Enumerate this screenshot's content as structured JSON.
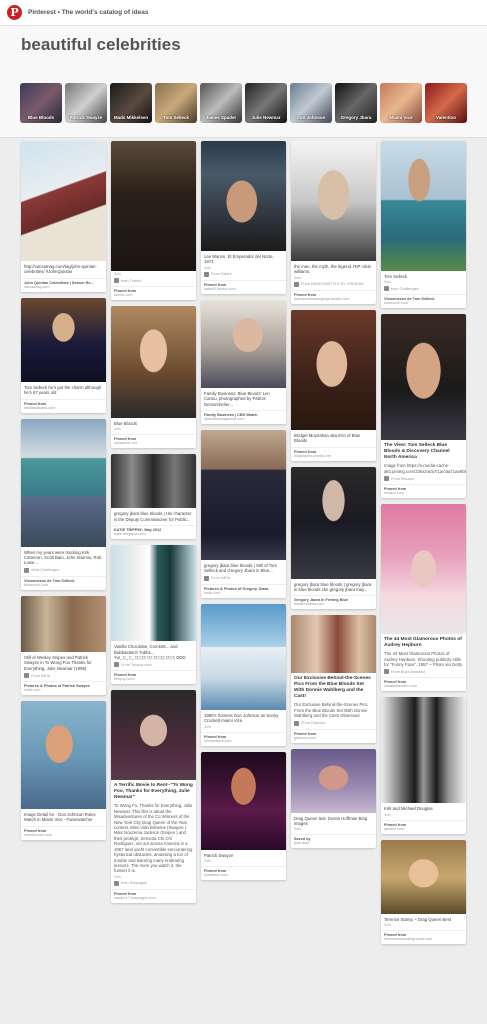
{
  "topbar": {
    "title": "Pinterest • The world's catalog of ideas",
    "logo": "P"
  },
  "header": {
    "title": "beautiful celebrities"
  },
  "chips": [
    {
      "label": "Blue Bloods",
      "bg": "linear-gradient(135deg,#3b3a5c,#7a5a6a 50%,#2a2a3a)"
    },
    {
      "label": "Patrick Swayze",
      "bg": "linear-gradient(135deg,#777,#d0d0d0 50%,#444)"
    },
    {
      "label": "Mads Mikkelsen",
      "bg": "linear-gradient(135deg,#1a1a1a,#5a4a40 55%,#111)"
    },
    {
      "label": "Tom Selleck",
      "bg": "linear-gradient(135deg,#8a7050,#c9a97a 50%,#4a3a28)"
    },
    {
      "label": "James Spader",
      "bg": "linear-gradient(135deg,#555,#bbb 50%,#333)"
    },
    {
      "label": "Julie Newmar",
      "bg": "linear-gradient(135deg,#222,#777 50%,#111)"
    },
    {
      "label": "Don Johnson",
      "bg": "linear-gradient(135deg,#6a7e90,#c0cad2 50%,#445)"
    },
    {
      "label": "Gregory Jbara",
      "bg": "linear-gradient(135deg,#111,#666 50%,#222)"
    },
    {
      "label": "Miami Vice",
      "bg": "linear-gradient(135deg,#c47a5a,#e8b890 50%,#8a4a3a)"
    },
    {
      "label": "Valentino",
      "bg": "linear-gradient(135deg,#8a1a1a,#d46a4a 50%,#5a1010)"
    }
  ],
  "columns": [
    [
      {
        "img_h": 120,
        "bg": "linear-gradient(160deg,#cfe3ec,#e8eef0 40%,#8a3a38 41%,#6a2a28 62%,#e9e3d6 63%)",
        "desc": "http://cacsamag.com/tag/john-quinlan-celebrities/ #JohnQuinlan",
        "count": "",
        "by": "",
        "src_label": "John Quinlan Celebrities | Search Re...",
        "src_url": "cacsamag.com"
      },
      {
        "img_h": 84,
        "bg": "radial-gradient(ellipse at 50% 35%,#d6b08a 0 18%,transparent 19%),linear-gradient(180deg,#6a4a30,#1a1a3a 55%,#0f0f22)",
        "desc": "Tom Selleck he's got the charm although he's 67 years old",
        "count": "",
        "by": "",
        "src_label": "Pinned from",
        "src_url": "takeawalkand.com"
      },
      {
        "img_h": 128,
        "bg": "linear-gradient(180deg,#8aa7c0,#d6dde2 30%,#4a9a9a 31%,#3a7a8a 60%,#5a6a8a 61%,#3a4a5a)",
        "desc": "When my years were tracking Kirk Cameron, Scott Baio, John Stamos, Rob Lowe...",
        "count": "",
        "by": "Vivia Challenges",
        "src_label": "Visionnesse de Tom Selleck",
        "src_url": "budecore.com"
      },
      {
        "img_h": 56,
        "bg": "linear-gradient(90deg,#6a5a4a,#c8b498 30%,#8a6a50 60%,#b49070)",
        "desc": "Still of Wesley Snipes and Patrick Swayze in To Wong Foo Thanks for Everything, Julie Newmar (1995)",
        "count": "",
        "by": "From IMDb",
        "src_label": "Pictures & Photos of Patrick Swayze",
        "src_url": "imdb.com"
      },
      {
        "img_h": 108,
        "bg": "radial-gradient(ellipse at 45% 40%,#d9a07a 0 20%,transparent 21%),linear-gradient(180deg,#8ab4cc,#6a9ab8 50%,#4a6a8a)",
        "desc": "Image Detail for - Don Johnson Rolex Watch in Miami Vice - Famewatcher",
        "count": "",
        "by": "",
        "src_label": "Pinned from",
        "src_url": "rolexforums.com"
      }
    ],
    [
      {
        "img_h": 130,
        "bg": "linear-gradient(180deg,#5a4a3a,#2a2018 40%,#1a1512)",
        "desc": "",
        "count": "3sfs",
        "by": "from Tumblr",
        "src_label": "Pinned from",
        "src_url": "tumblr.com"
      },
      {
        "img_h": 112,
        "bg": "radial-gradient(ellipse at 50% 40%,#e6c0a0 0 22%,transparent 23%),linear-gradient(180deg,#b08a60,#6a4a30 60%,#2a2a2a)",
        "desc": "Blue Bloods",
        "count": "3sfs",
        "by": "",
        "src_label": "Pinned from",
        "src_url": "cellardoor.net"
      },
      {
        "img_h": 54,
        "bg": "linear-gradient(90deg,#333,#8a8a8a 25%,#2a2a2a 50%,#777 75%,#333)",
        "desc": "gregory jbara blue bloods | His character is the Deputy Commissioner for Public...",
        "count": "",
        "by": "",
        "src_label": "KATIE TRIPPIN': May 2012",
        "src_url": "katie.blogspot.com"
      },
      {
        "img_h": 96,
        "bg": "linear-gradient(90deg,#c8e0e8,#f0f0f0 30%,#ffffff 45%,#2a5a5a 55%,#1a3a3a 70%,#c8e0e8)",
        "desc": "Vanilla Chocolate, Crockett... and Bubbastetch Tubbs... Yu!_!;;_!;;_!;!;!;!;!;!;!;!;!;!;!;!;!;!;!;!;!; DDD",
        "count": "",
        "by": "From Tenpop.com",
        "src_label": "Pinned from",
        "src_url": "flenpop.com"
      },
      {
        "img_h": 90,
        "bg": "radial-gradient(ellipse at 50% 45%,#d4b4a4 0 22%,transparent 23%),linear-gradient(180deg,#2a2a2a,#4a2a3a 60%,#5a3a4a)",
        "desc": "A Terrific Movie to Rent--\"To Wong Foo, Thanks for Everything, Julie Newmar\"",
        "bold": true,
        "desc2": "To Wong Fu, Thanks for Everything, Julie Newmar. This film is about the Misadventures of the Co Winners of the New York City Drag Queen of the Year contest. Miss Vida Boheme (Swayze ) Miss Noxzema Jackson (Snipes ) and their protégé, Senorita Chi Chi Rodriguez, set out across America in a 1967 land yacht convertible encountering hysterical obstacles, amassing a ton of trouble and learning many endearing lessons. The more you watch it, the funnier it is.",
        "count": "3sfs",
        "by": "from Hubpages",
        "src_label": "Pinned from",
        "src_url": "zander17.hubpages.com"
      }
    ],
    [
      {
        "img_h": 110,
        "bg": "radial-gradient(ellipse at 48% 55%,#c89a7a 0 24%,transparent 25%),linear-gradient(180deg,#2a3a4a,#4a5a6a 30%,#1a1a1a)",
        "desc": "Lee Marvin, El Emperador del Norte, 1973",
        "count": "3sfs",
        "by": "Emm Sabell",
        "src_label": "Pinned from",
        "src_url": "sabell3.tumblr.com"
      },
      {
        "img_h": 88,
        "bg": "radial-gradient(ellipse at 55% 40%,#ddb8a0 0 22%,transparent 23%),linear-gradient(180deg,#e8e4dc,#a8a098 55%,#4a4a5a)",
        "desc": "Family Business: Blue Bloods' Len Cariou, photographed by Patrick Demarchelier...",
        "count": "",
        "by": "",
        "src_label": "Family Business | CBS Watch",
        "src_url": "cbswatchmagazine.com"
      },
      {
        "img_h": 130,
        "bg": "linear-gradient(180deg,#c0a890,#8a6a58 30%,#2a2a3a 31%,#1a1a2a 80%,#3a3a4a)",
        "desc": "gregory jbara blue bloods | Still of Tom Selleck and Gregory Jbara in Blue...",
        "count": "",
        "by": "From IMDb",
        "src_label": "Pictures & Photos of Gregory Jbara",
        "src_url": "imdb.com"
      },
      {
        "img_h": 106,
        "bg": "linear-gradient(180deg,#5a9ac8,#a8d0e8 40%,#e8f0f4 41%,#c8d8e4 70%,#5a8ab0)",
        "desc": "1980's hotness Don Johnson as Sonny Crockett miami Vice.",
        "count": "3sfs",
        "by": "",
        "src_label": "Pinned from",
        "src_url": "ohmymiami.com"
      },
      {
        "img_h": 98,
        "bg": "radial-gradient(ellipse at 50% 35%,#c47a5a 0 20%,transparent 21%),linear-gradient(180deg,#1a0a1a,#5a1a4a 60%,#2a0a2a)",
        "desc": "Patrick Swayze",
        "count": "3sfs",
        "by": "",
        "src_label": "Pinned from",
        "src_url": "suitafeed.com"
      }
    ],
    [
      {
        "img_h": 120,
        "bg": "radial-gradient(ellipse at 50% 45%,#d8c0a8 0 26%,transparent 27%),linear-gradient(180deg,#f4f4f4,#c8c8c8 50%,#3a3a3a)",
        "desc": "the man, the myth, the legend. RIP robin williams.",
        "count": "3sfs",
        "by": "From RANDOMSTYLE BY VIRGINIA",
        "src_label": "Pinned from",
        "src_url": "hanukcrefoodorginga.tumblr.com"
      },
      {
        "img_h": 120,
        "bg": "radial-gradient(ellipse at 48% 45%,#e0b89c 0 24%,transparent 25%),linear-gradient(180deg,#6a3a2a,#3a2018 60%,#2a1810)",
        "desc": "Bridget Moynahan aka Erin of Blue Bloods",
        "count": "",
        "by": "",
        "src_label": "Pinned from",
        "src_url": "wallpapers-photos.net"
      },
      {
        "img_h": 112,
        "bg": "radial-gradient(ellipse at 50% 30%,#d0b8a8 0 18%,transparent 19%),linear-gradient(180deg,#2a2a2a,#1a1a22 50%,#3a3a44)",
        "desc": "gregory jbara blue bloods | gregory jbara in blue bloods cbs gregory jbara may...",
        "count": "",
        "by": "",
        "src_label": "Gregory Jbara In Feeling Blue",
        "src_url": "theatermania.com"
      },
      {
        "img_h": 58,
        "bg": "linear-gradient(90deg,#aa8870,#e0c8b0 30%,#8a4a3a 55%,#dcc0a0 80%,#aa8870)",
        "desc": "Our Exclusive Behind-the-Scenes Pics From the Blue Bloods Set With Donnie Wahlberg and the Cast!",
        "bold": true,
        "desc2": "Our Exclusive Behind-the-Scenes Pics From the Blue Bloods Set With Donnie Wahlberg and the Cast! Obsessed",
        "count": "",
        "by": "From Glamour",
        "src_label": "Pinned from",
        "src_url": "glamour.com"
      },
      {
        "img_h": 64,
        "bg": "radial-gradient(ellipse at 50% 45%,#d09888 0 24%,transparent 25%),linear-gradient(180deg,#6a5a8a,#9a8ab0 60%,#c8b8d0)",
        "desc": "Drag Queen test: Dustin Hoffman Bing images",
        "count": "3sfs",
        "by": "",
        "src_label": "Saved by",
        "src_url": "jose diaz"
      }
    ],
    [
      {
        "img_h": 130,
        "bg": "radial-gradient(ellipse at 45% 30%,#c8a080 0 16%,transparent 17%),linear-gradient(180deg,#c8dce8,#a8c0d0 45%,#3a8a9a 46%,#2a6a7a 75%,#5a8a4a)",
        "desc": "Tom Selleck",
        "count": "3sfs",
        "by": "from Challenges",
        "src_label": "Visionnesse de Tom Selleck",
        "src_url": "budecore.com"
      },
      {
        "img_h": 126,
        "bg": "radial-gradient(ellipse at 50% 45%,#d4a484 0 28%,transparent 29%),linear-gradient(180deg,#3a2a22,#1a1a1a 60%,#3a3a44)",
        "desc": "The View: Tom Selleck Blue Bloods & Discovery Channel North America",
        "bold": true,
        "desc2": "Image from https://s-media-cache-ak0.pinimg.com/236x/c6/a7/1a/c6a71ae6b97c432d7605d77447854fd.jpg",
        "count": "",
        "by": "From Recapo",
        "src_label": "Pinned from",
        "src_url": "recapo.com"
      },
      {
        "img_h": 130,
        "bg": "radial-gradient(ellipse at 50% 50%,#e8c8c0 0 20%,transparent 21%),linear-gradient(180deg,#e07aa0,#e8a0bc 40%,#f4d8e0 70%,#e8e8e8)",
        "desc": "The 44 Most Glamorous Photos of Audrey Hepburn",
        "bold": true,
        "desc2": "The 44 Most Glamorous Photos of Audrey Hepburn. Shooting publicity stills for \"Funny Face\", 1957 ~ Photo via Getty",
        "count": "",
        "by": "From Buzz Beautiful",
        "src_label": "Pinned from",
        "src_url": "rosaltesland64.com"
      },
      {
        "img_h": 106,
        "bg": "linear-gradient(90deg,#eee,#888 20%,#1a1a1a 40%,#9a9a9a 50%,#1a1a1a 65%,#999 80%,#eee)",
        "desc": "Kirk and Michael Douglas",
        "count": "3sfs",
        "by": "",
        "src_label": "Pinned from",
        "src_url": "apstein.com"
      },
      {
        "img_h": 74,
        "bg": "radial-gradient(ellipse at 50% 45%,#e8c098 0 24%,transparent 25%),linear-gradient(180deg,#9a7a4a,#c8a870 50%,#5a4a2a)",
        "desc": "Terence Stamp ~ Drag Queen Best",
        "count": "3sfs",
        "by": "",
        "src_label": "Pinned from",
        "src_url": "demoncelaunderground.com"
      }
    ]
  ]
}
